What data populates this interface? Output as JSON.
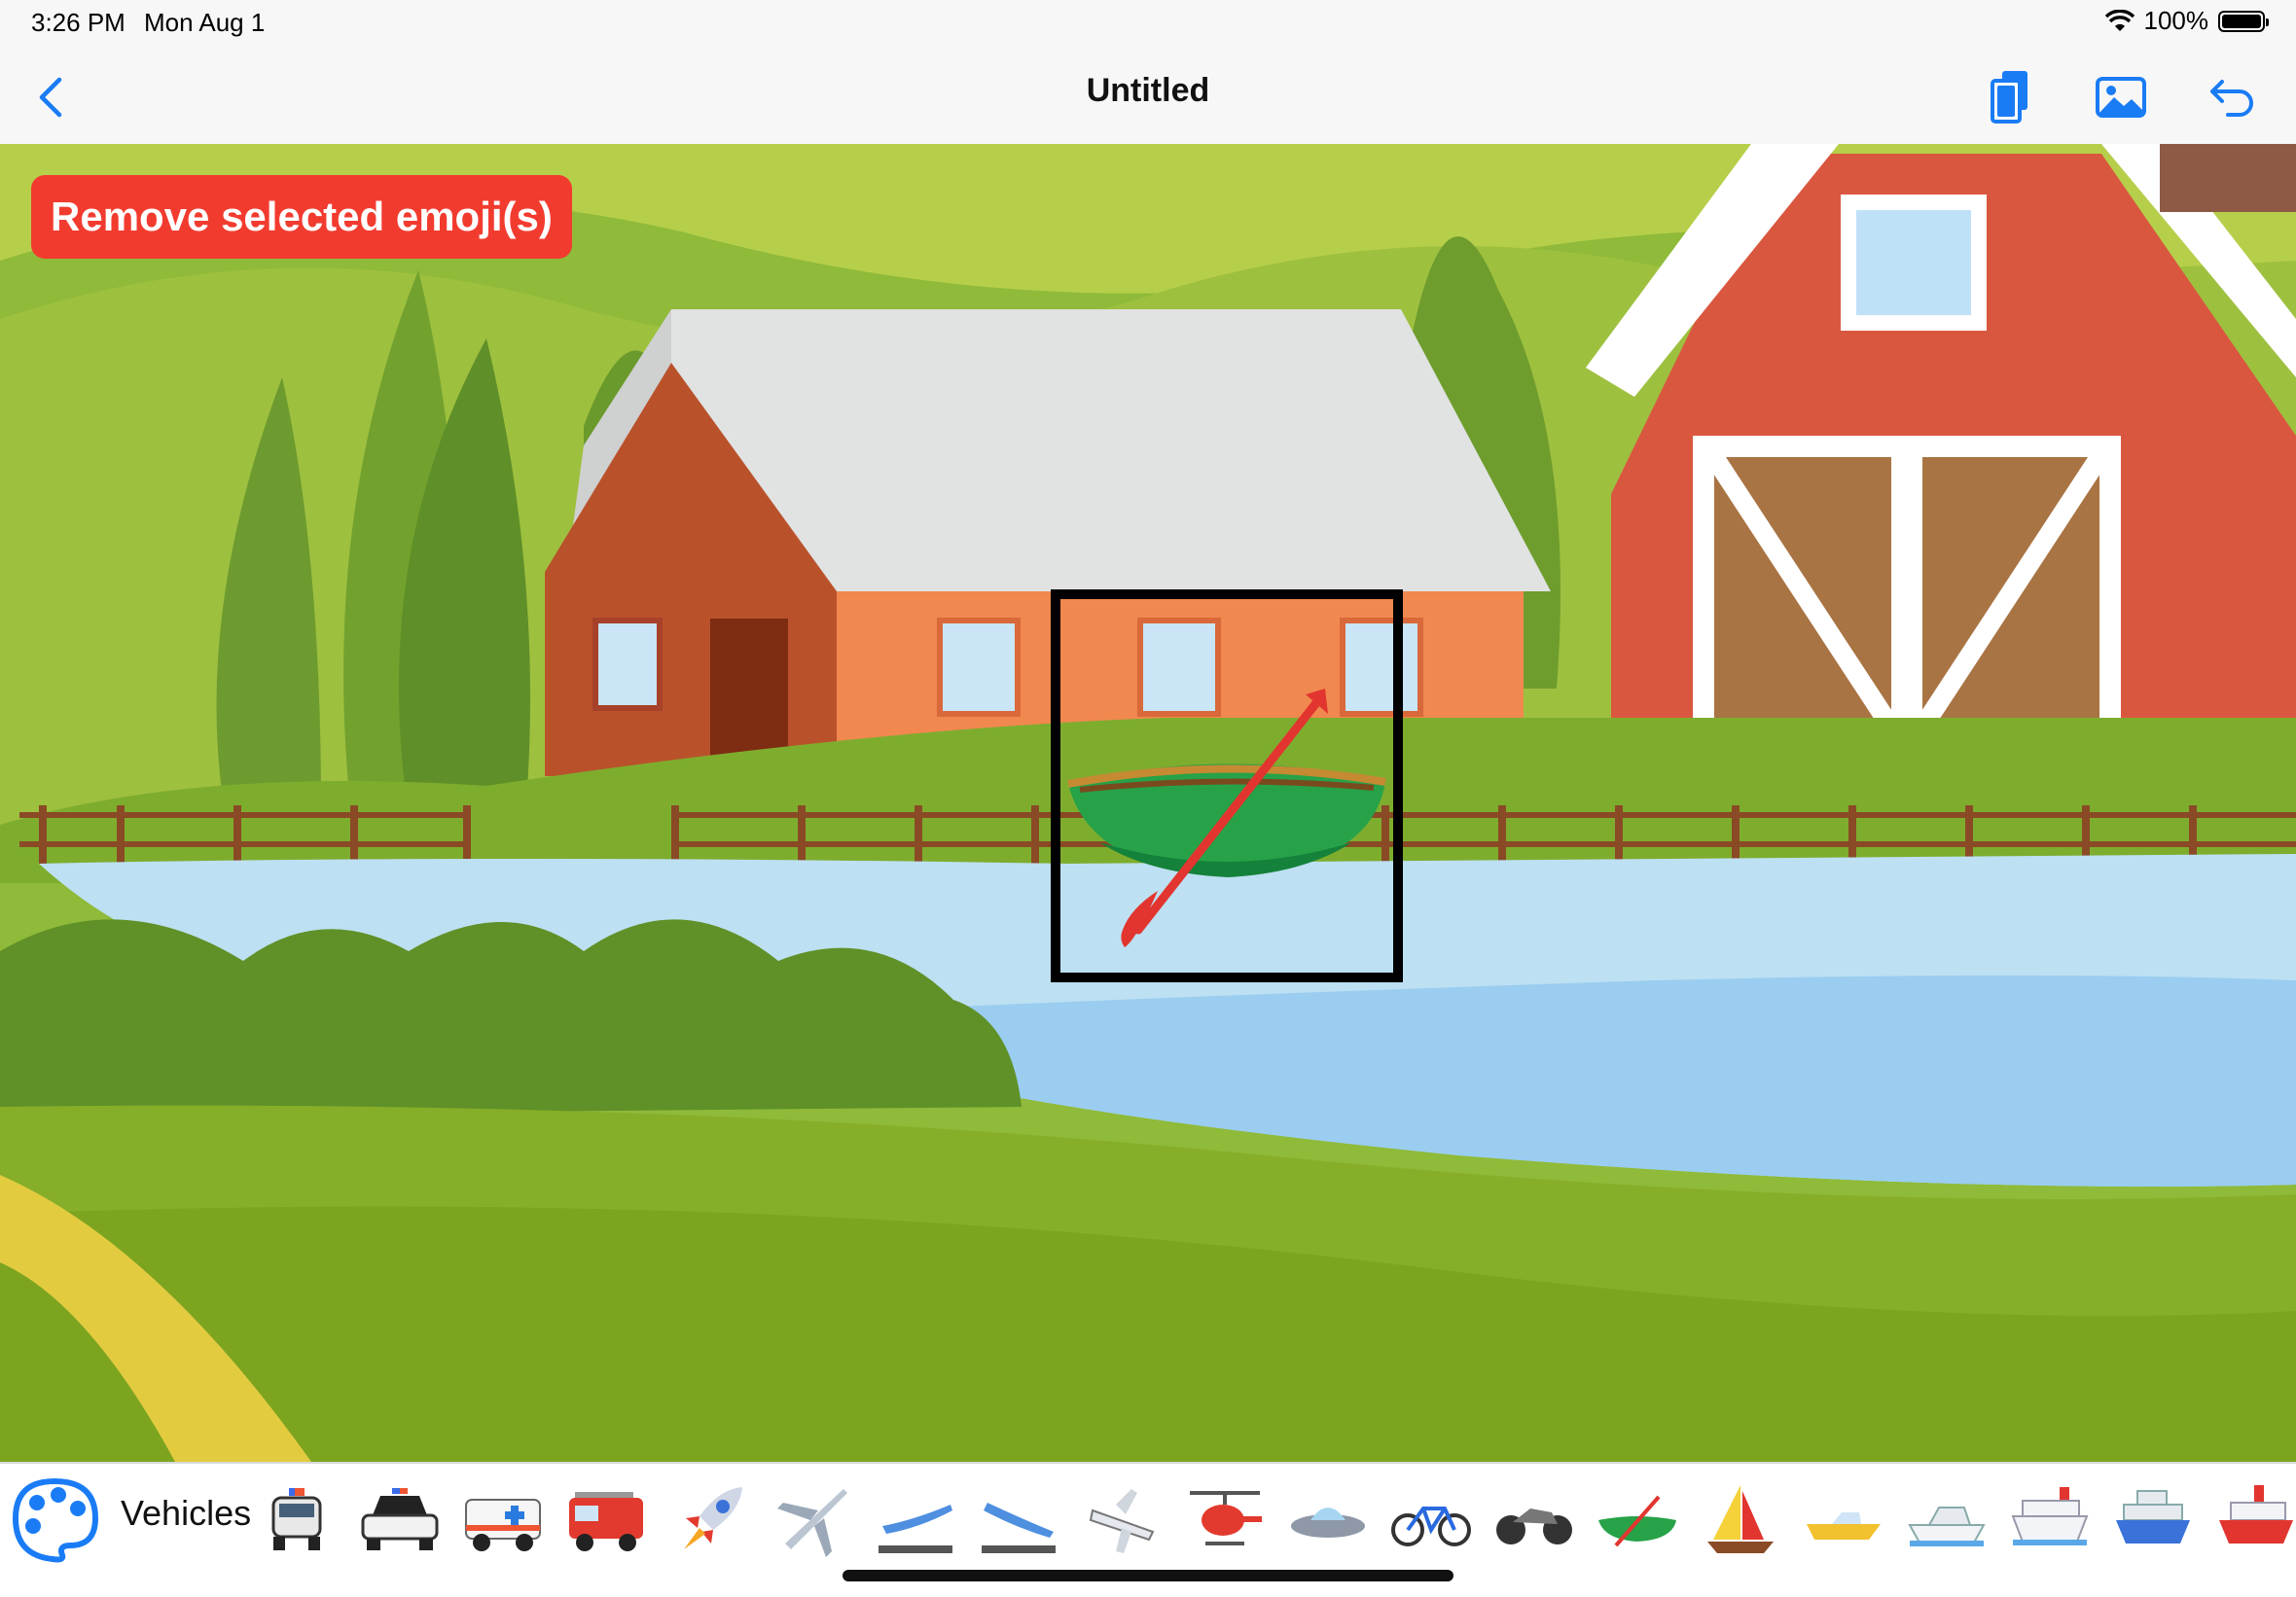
{
  "status": {
    "time": "3:26 PM",
    "date": "Mon Aug 1",
    "battery": "100%"
  },
  "nav": {
    "title": "Untitled"
  },
  "actions": {
    "remove_label": "Remove selected emoji(s)"
  },
  "palette": {
    "category": "Vehicles",
    "emojis": [
      "police-car-front",
      "police-car",
      "ambulance",
      "fire-engine",
      "rocket",
      "airplane",
      "airplane-departure",
      "airplane-arrival",
      "small-airplane",
      "helicopter",
      "flying-saucer",
      "bicycle",
      "motorcycle",
      "canoe",
      "sailboat",
      "speedboat",
      "motor-boat",
      "passenger-ship",
      "ferry",
      "ship"
    ]
  },
  "colors": {
    "accent": "#1a7cf5",
    "remove": "#f23b2f",
    "selection": "#000000"
  }
}
